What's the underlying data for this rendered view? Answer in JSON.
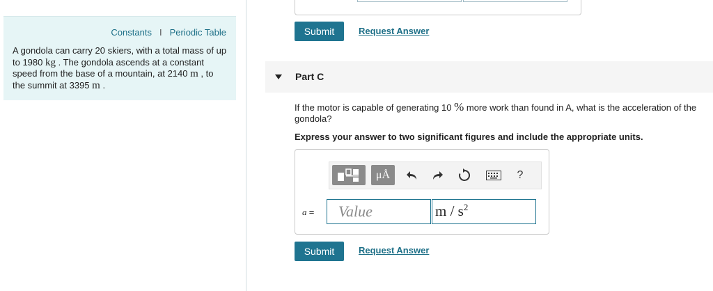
{
  "left_pane": {
    "link_constants": "Constants",
    "separator": "I",
    "link_periodic": "Periodic Table",
    "problem": {
      "t1": "A gondola can carry 20 skiers, with a total mass of up to 1980 ",
      "u1": "kg",
      "t2": " . The gondola ascends at a constant speed from the base of a mountain, at 2140 ",
      "u2": "m",
      "t3": " , to the summit at 3395 ",
      "u3": "m",
      "t4": " ."
    }
  },
  "previous_part": {
    "submit_label": "Submit",
    "request_label": "Request Answer"
  },
  "part_c": {
    "title": "Part C",
    "question_1": "If the motor is capable of generating 10 ",
    "question_percent": "%",
    "question_2": " more work than found in A, what is the acceleration of the gondola?",
    "instruction": "Express your answer to two significant figures and include the appropriate units.",
    "toolbar": {
      "templates_icon": "templates-icon",
      "units_label": "μÅ",
      "undo_icon": "undo-icon",
      "redo_icon": "redo-icon",
      "reset_icon": "reset-icon",
      "keyboard_icon": "keyboard-icon",
      "help_label": "?"
    },
    "variable": "a",
    "equals": "=",
    "value_placeholder": "Value",
    "units_base": "m / s",
    "units_exp": "2",
    "submit_label": "Submit",
    "request_label": "Request Answer"
  },
  "colors": {
    "accent": "#1f7490",
    "link": "#1d6f87",
    "left_pane_bg": "#e6f5f6"
  }
}
